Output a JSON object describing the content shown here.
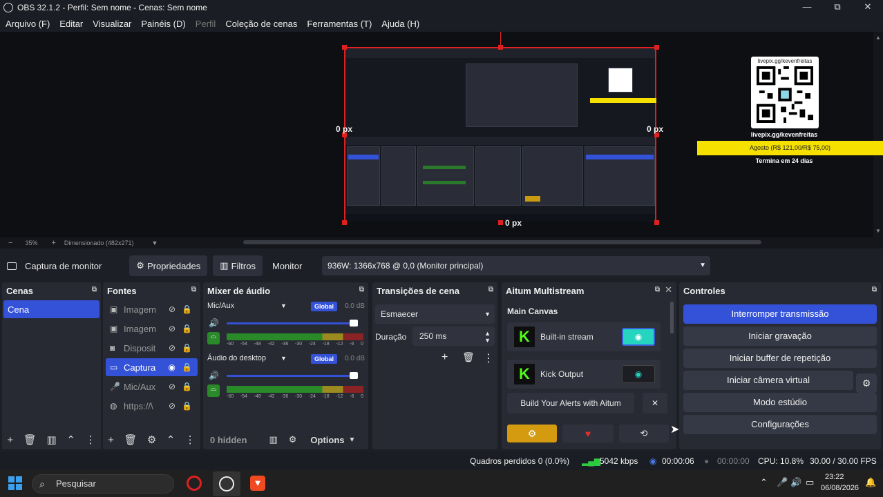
{
  "window": {
    "title": "OBS 32.1.2 - Perfil: Sem nome - Cenas: Sem nome",
    "minimize": "—",
    "maximize": "⧉",
    "close": "✕"
  },
  "menu": [
    "Arquivo (F)",
    "Editar",
    "Visualizar",
    "Painéis (D)",
    "Perfil",
    "Coleção de cenas",
    "Ferramentas (T)",
    "Ajuda (H)"
  ],
  "preview": {
    "px_top": "0 px",
    "px_left": "0 px",
    "px_right": "0 px",
    "px_bottom": "0 px",
    "qr_url": "livepix.gg/kevenfreitas",
    "qr_link": "livepix.gg/kevenfreitas",
    "qr_goal": "Agosto (R$ 121,00/R$ 75,00)",
    "qr_end": "Termina em 24 dias"
  },
  "zoom": {
    "minus": "−",
    "value": "35%",
    "plus": "+",
    "scaled": "Dimensionado (482x271)"
  },
  "source_toolbar": {
    "source_name": "Captura de monitor",
    "properties": "Propriedades",
    "filters": "Filtros",
    "monitor_label": "Monitor",
    "monitor_value": "936W: 1366x768 @ 0,0 (Monitor principal)"
  },
  "scenes": {
    "title": "Cenas",
    "items": [
      "Cena"
    ]
  },
  "sources": {
    "title": "Fontes",
    "items": [
      {
        "label": "Imagem",
        "icon": "image-icon"
      },
      {
        "label": "Imagem",
        "icon": "image-icon"
      },
      {
        "label": "Disposit",
        "icon": "camera-icon"
      },
      {
        "label": "Captura",
        "icon": "monitor-icon"
      },
      {
        "label": "Mic/Aux",
        "icon": "mic-icon"
      },
      {
        "label": "https://\\",
        "icon": "globe-icon"
      }
    ]
  },
  "mixer": {
    "title": "Mixer de áudio",
    "channels": [
      {
        "name": "Mic/Aux",
        "badge": "Global",
        "db": "0.0 dB"
      },
      {
        "name": "Áudio do desktop",
        "badge": "Global",
        "db": "0.0 dB"
      }
    ],
    "scale": [
      "-60",
      "-54",
      "-48",
      "-42",
      "-36",
      "-30",
      "-24",
      "-18",
      "-12",
      "-6",
      "0"
    ],
    "hidden": "0 hidden",
    "options": "Options"
  },
  "transitions": {
    "title": "Transições de cena",
    "selected": "Esmaecer",
    "duration_label": "Duração",
    "duration_value": "250 ms"
  },
  "aitum": {
    "title": "Aitum Multistream",
    "canvas": "Main Canvas",
    "outputs": [
      "Built-in stream",
      "Kick Output"
    ],
    "alerts": "Build Your Alerts with Aitum"
  },
  "controls": {
    "title": "Controles",
    "buttons": [
      "Interromper transmissão",
      "Iniciar gravação",
      "Iniciar buffer de repetição",
      "Iniciar câmera virtual",
      "Modo estúdio",
      "Configurações"
    ]
  },
  "status": {
    "dropped": "Quadros perdidos 0 (0.0%)",
    "kbps": "5042 kbps",
    "stream_time": "00:00:06",
    "rec_time": "00:00:00",
    "cpu": "CPU: 10.8%",
    "fps": "30.00 / 30.00 FPS"
  },
  "taskbar": {
    "search": "Pesquisar",
    "time": "23:22",
    "date": "06/08/2026"
  }
}
